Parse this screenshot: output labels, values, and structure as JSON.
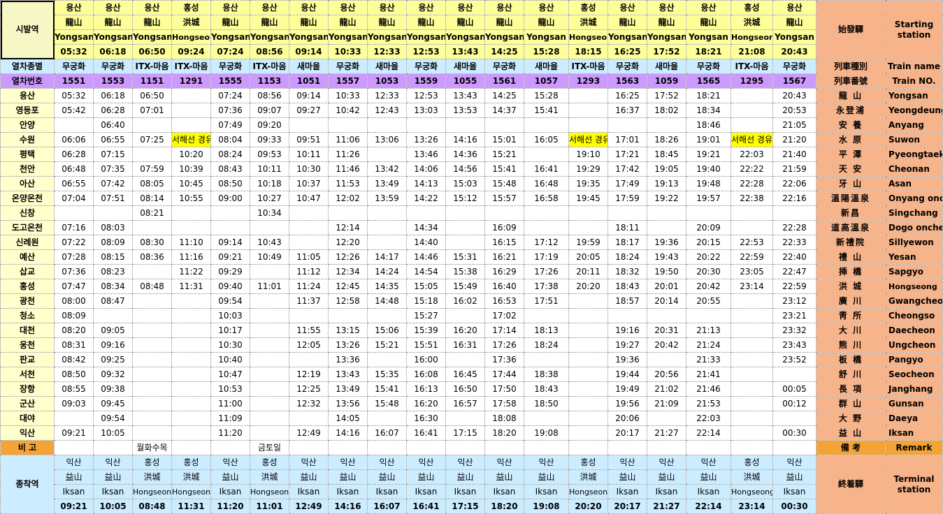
{
  "labels": {
    "start": "시발역",
    "start_hanja": "始發驛",
    "start_eng": "Starting station",
    "type": "열차종별",
    "type_hanja": "列車種別",
    "type_eng": "Train name",
    "no": "열차번호",
    "no_hanja": "列車番號",
    "no_eng": "Train NO.",
    "remark": "비 고",
    "remark_hanja": "備 考",
    "remark_eng": "Remark",
    "terminal": "종착역",
    "terminal_hanja": "終着驛",
    "terminal_eng": "Terminal station"
  },
  "trains": [
    {
      "sk": "용산",
      "sh": "龍山",
      "se": "Yongsan",
      "st": "05:32",
      "type": "무궁화",
      "no": "1551",
      "remark": "",
      "tk": "익산",
      "th": "益山",
      "te": "Iksan",
      "tt": "09:21"
    },
    {
      "sk": "용산",
      "sh": "龍山",
      "se": "Yongsan",
      "st": "06:18",
      "type": "무궁화",
      "no": "1553",
      "remark": "",
      "tk": "익산",
      "th": "益山",
      "te": "Iksan",
      "tt": "10:05"
    },
    {
      "sk": "용산",
      "sh": "龍山",
      "se": "Yongsan",
      "st": "06:50",
      "type": "ITX-마음",
      "no": "1151",
      "remark": "월화수목",
      "tk": "홍성",
      "th": "洪城",
      "te": "Hongseong",
      "tt": "08:48"
    },
    {
      "sk": "홍성",
      "sh": "洪城",
      "se": "Hongseong",
      "st": "09:24",
      "type": "ITX-마음",
      "no": "1291",
      "remark": "",
      "tk": "홍성",
      "th": "洪城",
      "te": "Hongseong",
      "tt": "11:31"
    },
    {
      "sk": "용산",
      "sh": "龍山",
      "se": "Yongsan",
      "st": "07:24",
      "type": "무궁화",
      "no": "1555",
      "remark": "",
      "tk": "익산",
      "th": "益山",
      "te": "Iksan",
      "tt": "11:20"
    },
    {
      "sk": "용산",
      "sh": "龍山",
      "se": "Yongsan",
      "st": "08:56",
      "type": "ITX-마음",
      "no": "1153",
      "remark": "금토일",
      "tk": "홍성",
      "th": "洪城",
      "te": "Hongseong",
      "tt": "11:01"
    },
    {
      "sk": "용산",
      "sh": "龍山",
      "se": "Yongsan",
      "st": "09:14",
      "type": "새마을",
      "no": "1051",
      "remark": "",
      "tk": "익산",
      "th": "益山",
      "te": "Iksan",
      "tt": "12:49"
    },
    {
      "sk": "용산",
      "sh": "龍山",
      "se": "Yongsan",
      "st": "10:33",
      "type": "무궁화",
      "no": "1557",
      "remark": "",
      "tk": "익산",
      "th": "益山",
      "te": "Iksan",
      "tt": "14:16"
    },
    {
      "sk": "용산",
      "sh": "龍山",
      "se": "Yongsan",
      "st": "12:33",
      "type": "새마을",
      "no": "1053",
      "remark": "",
      "tk": "익산",
      "th": "益山",
      "te": "Iksan",
      "tt": "16:07"
    },
    {
      "sk": "용산",
      "sh": "龍山",
      "se": "Yongsan",
      "st": "12:53",
      "type": "무궁화",
      "no": "1559",
      "remark": "",
      "tk": "익산",
      "th": "益山",
      "te": "Iksan",
      "tt": "16:41"
    },
    {
      "sk": "용산",
      "sh": "龍山",
      "se": "Yongsan",
      "st": "13:43",
      "type": "새마을",
      "no": "1055",
      "remark": "",
      "tk": "익산",
      "th": "益山",
      "te": "Iksan",
      "tt": "17:15"
    },
    {
      "sk": "용산",
      "sh": "龍山",
      "se": "Yongsan",
      "st": "14:25",
      "type": "무궁화",
      "no": "1561",
      "remark": "",
      "tk": "익산",
      "th": "益山",
      "te": "Iksan",
      "tt": "18:20"
    },
    {
      "sk": "용산",
      "sh": "龍山",
      "se": "Yongsan",
      "st": "15:28",
      "type": "새마을",
      "no": "1057",
      "remark": "",
      "tk": "익산",
      "th": "益山",
      "te": "Iksan",
      "tt": "19:08"
    },
    {
      "sk": "홍성",
      "sh": "洪城",
      "se": "Hongseong",
      "st": "18:15",
      "type": "ITX-마음",
      "no": "1293",
      "remark": "",
      "tk": "홍성",
      "th": "洪城",
      "te": "Hongseong",
      "tt": "20:20"
    },
    {
      "sk": "용산",
      "sh": "龍山",
      "se": "Yongsan",
      "st": "16:25",
      "type": "무궁화",
      "no": "1563",
      "remark": "",
      "tk": "익산",
      "th": "益山",
      "te": "Iksan",
      "tt": "20:17"
    },
    {
      "sk": "용산",
      "sh": "龍山",
      "se": "Yongsan",
      "st": "17:52",
      "type": "새마을",
      "no": "1059",
      "remark": "",
      "tk": "익산",
      "th": "益山",
      "te": "Iksan",
      "tt": "21:27"
    },
    {
      "sk": "용산",
      "sh": "龍山",
      "se": "Yongsan",
      "st": "18:21",
      "type": "무궁화",
      "no": "1565",
      "remark": "",
      "tk": "익산",
      "th": "益山",
      "te": "Iksan",
      "tt": "22:14"
    },
    {
      "sk": "홍성",
      "sh": "洪城",
      "se": "Hongseong",
      "st": "21:08",
      "type": "ITX-마음",
      "no": "1295",
      "remark": "",
      "tk": "홍성",
      "th": "洪城",
      "te": "Hongseong",
      "tt": "23:14"
    },
    {
      "sk": "용산",
      "sh": "龍山",
      "se": "Yongsan",
      "st": "20:43",
      "type": "무궁화",
      "no": "1567",
      "remark": "",
      "tk": "익산",
      "th": "益山",
      "te": "Iksan",
      "tt": "00:30"
    }
  ],
  "stations": [
    {
      "ko": "용산",
      "hanja": "龍 山",
      "en": "Yongsan",
      "times": [
        "05:32",
        "06:18",
        "06:50",
        "",
        "07:24",
        "08:56",
        "09:14",
        "10:33",
        "12:33",
        "12:53",
        "13:43",
        "14:25",
        "15:28",
        "",
        "16:25",
        "17:52",
        "18:21",
        "",
        "20:43"
      ]
    },
    {
      "ko": "영등포",
      "hanja": "永登浦",
      "en": "Yeongdeungpo",
      "times": [
        "05:42",
        "06:28",
        "07:01",
        "",
        "07:36",
        "09:07",
        "09:27",
        "10:42",
        "12:43",
        "13:03",
        "13:53",
        "14:37",
        "15:41",
        "",
        "16:37",
        "18:02",
        "18:34",
        "",
        "20:53"
      ]
    },
    {
      "ko": "안양",
      "hanja": "安 養",
      "en": "Anyang",
      "times": [
        "",
        "06:40",
        "",
        "",
        "07:49",
        "09:20",
        "",
        "",
        "",
        "",
        "",
        "",
        "",
        "",
        "",
        "",
        "18:46",
        "",
        "21:05"
      ]
    },
    {
      "ko": "수원",
      "hanja": "水 原",
      "en": "Suwon",
      "times": [
        "06:06",
        "06:55",
        "07:25",
        "서해선 경유",
        "08:04",
        "09:33",
        "09:51",
        "11:06",
        "13:06",
        "13:26",
        "14:16",
        "15:01",
        "16:05",
        "서해선 경유",
        "17:01",
        "18:26",
        "19:01",
        "서해선 경유",
        "21:20"
      ]
    },
    {
      "ko": "평택",
      "hanja": "平 澤",
      "en": "Pyeongtaek",
      "times": [
        "06:28",
        "07:15",
        "",
        "10:20",
        "08:24",
        "09:53",
        "10:11",
        "11:26",
        "",
        "13:46",
        "14:36",
        "15:21",
        "",
        "19:10",
        "17:21",
        "18:45",
        "19:21",
        "22:03",
        "21:40"
      ]
    },
    {
      "ko": "천안",
      "hanja": "天 安",
      "en": "Cheonan",
      "times": [
        "06:48",
        "07:35",
        "07:59",
        "10:39",
        "08:43",
        "10:11",
        "10:30",
        "11:46",
        "13:42",
        "14:06",
        "14:56",
        "15:41",
        "16:41",
        "19:29",
        "17:42",
        "19:05",
        "19:40",
        "22:22",
        "21:59"
      ]
    },
    {
      "ko": "아산",
      "hanja": "牙 山",
      "en": "Asan",
      "times": [
        "06:55",
        "07:42",
        "08:05",
        "10:45",
        "08:50",
        "10:18",
        "10:37",
        "11:53",
        "13:49",
        "14:13",
        "15:03",
        "15:48",
        "16:48",
        "19:35",
        "17:49",
        "19:13",
        "19:48",
        "22:28",
        "22:06"
      ]
    },
    {
      "ko": "온양온천",
      "hanja": "溫陽溫泉",
      "en": "Onyang oncheon",
      "times": [
        "07:04",
        "07:51",
        "08:14",
        "10:55",
        "09:00",
        "10:27",
        "10:47",
        "12:02",
        "13:59",
        "14:22",
        "15:12",
        "15:57",
        "16:58",
        "19:45",
        "17:59",
        "19:22",
        "19:57",
        "22:38",
        "22:16"
      ]
    },
    {
      "ko": "신창",
      "hanja": "新昌",
      "en": "Singchang",
      "times": [
        "",
        "",
        "08:21",
        "",
        "",
        "10:34",
        "",
        "",
        "",
        "",
        "",
        "",
        "",
        "",
        "",
        "",
        "",
        "",
        ""
      ]
    },
    {
      "ko": "도고온천",
      "hanja": "道高溫泉",
      "en": "Dogo oncheon",
      "times": [
        "07:16",
        "08:03",
        "",
        "",
        "",
        "",
        "",
        "12:14",
        "",
        "14:34",
        "",
        "16:09",
        "",
        "",
        "18:11",
        "",
        "20:09",
        "",
        "22:28"
      ]
    },
    {
      "ko": "신례원",
      "hanja": "新禮院",
      "en": "Sillyewon",
      "times": [
        "07:22",
        "08:09",
        "08:30",
        "11:10",
        "09:14",
        "10:43",
        "",
        "12:20",
        "",
        "14:40",
        "",
        "16:15",
        "17:12",
        "19:59",
        "18:17",
        "19:36",
        "20:15",
        "22:53",
        "22:33"
      ]
    },
    {
      "ko": "예산",
      "hanja": "禮 山",
      "en": "Yesan",
      "times": [
        "07:28",
        "08:15",
        "08:36",
        "11:16",
        "09:21",
        "10:49",
        "11:05",
        "12:26",
        "14:17",
        "14:46",
        "15:31",
        "16:21",
        "17:19",
        "20:05",
        "18:24",
        "19:43",
        "20:22",
        "22:59",
        "22:40"
      ]
    },
    {
      "ko": "삽교",
      "hanja": "揷 橋",
      "en": "Sapgyo",
      "times": [
        "07:36",
        "08:23",
        "",
        "11:22",
        "09:29",
        "",
        "11:12",
        "12:34",
        "14:24",
        "14:54",
        "15:38",
        "16:29",
        "17:26",
        "20:11",
        "18:32",
        "19:50",
        "20:30",
        "23:05",
        "22:47"
      ]
    },
    {
      "ko": "홍성",
      "hanja": "洪 城",
      "en": "Hongseong",
      "times": [
        "07:47",
        "08:34",
        "08:48",
        "11:31",
        "09:40",
        "11:01",
        "11:24",
        "12:45",
        "14:35",
        "15:05",
        "15:49",
        "16:40",
        "17:38",
        "20:20",
        "18:43",
        "20:01",
        "20:42",
        "23:14",
        "22:59"
      ]
    },
    {
      "ko": "광천",
      "hanja": "廣 川",
      "en": "Gwangcheon",
      "times": [
        "08:00",
        "08:47",
        "",
        "",
        "09:54",
        "",
        "11:37",
        "12:58",
        "14:48",
        "15:18",
        "16:02",
        "16:53",
        "17:51",
        "",
        "18:57",
        "20:14",
        "20:55",
        "",
        "23:12"
      ]
    },
    {
      "ko": "청소",
      "hanja": "靑 所",
      "en": "Cheongso",
      "times": [
        "08:09",
        "",
        "",
        "",
        "10:03",
        "",
        "",
        "",
        "",
        "15:27",
        "",
        "17:02",
        "",
        "",
        "",
        "",
        "",
        "",
        "23:21"
      ]
    },
    {
      "ko": "대천",
      "hanja": "大 川",
      "en": "Daecheon",
      "times": [
        "08:20",
        "09:05",
        "",
        "",
        "10:17",
        "",
        "11:55",
        "13:15",
        "15:06",
        "15:39",
        "16:20",
        "17:14",
        "18:13",
        "",
        "19:16",
        "20:31",
        "21:13",
        "",
        "23:32"
      ]
    },
    {
      "ko": "웅천",
      "hanja": "熊 川",
      "en": "Ungcheon",
      "times": [
        "08:31",
        "09:16",
        "",
        "",
        "10:30",
        "",
        "12:05",
        "13:26",
        "15:21",
        "15:51",
        "16:31",
        "17:26",
        "18:24",
        "",
        "19:27",
        "20:42",
        "21:24",
        "",
        "23:43"
      ]
    },
    {
      "ko": "판교",
      "hanja": "板 橋",
      "en": "Pangyo",
      "times": [
        "08:42",
        "09:25",
        "",
        "",
        "10:40",
        "",
        "",
        "13:36",
        "",
        "16:00",
        "",
        "17:36",
        "",
        "",
        "19:36",
        "",
        "21:33",
        "",
        "23:52"
      ]
    },
    {
      "ko": "서천",
      "hanja": "舒 川",
      "en": "Seocheon",
      "times": [
        "08:50",
        "09:32",
        "",
        "",
        "10:47",
        "",
        "12:19",
        "13:43",
        "15:35",
        "16:08",
        "16:45",
        "17:44",
        "18:38",
        "",
        "19:44",
        "20:56",
        "21:41",
        "",
        ""
      ]
    },
    {
      "ko": "장항",
      "hanja": "長 項",
      "en": "Janghang",
      "times": [
        "08:55",
        "09:38",
        "",
        "",
        "10:53",
        "",
        "12:25",
        "13:49",
        "15:41",
        "16:13",
        "16:50",
        "17:50",
        "18:43",
        "",
        "19:49",
        "21:02",
        "21:46",
        "",
        "00:05"
      ]
    },
    {
      "ko": "군산",
      "hanja": "群 山",
      "en": "Gunsan",
      "times": [
        "09:03",
        "09:45",
        "",
        "",
        "11:00",
        "",
        "12:32",
        "13:56",
        "15:48",
        "16:20",
        "16:57",
        "17:58",
        "18:50",
        "",
        "19:56",
        "21:09",
        "21:53",
        "",
        "00:12"
      ]
    },
    {
      "ko": "대야",
      "hanja": "大 野",
      "en": "Daeya",
      "times": [
        "",
        "09:54",
        "",
        "",
        "11:09",
        "",
        "",
        "14:05",
        "",
        "16:30",
        "",
        "18:08",
        "",
        "",
        "20:06",
        "",
        "22:03",
        "",
        ""
      ]
    },
    {
      "ko": "익산",
      "hanja": "益 山",
      "en": "Iksan",
      "times": [
        "09:21",
        "10:05",
        "",
        "",
        "11:20",
        "",
        "12:49",
        "14:16",
        "16:07",
        "16:41",
        "17:15",
        "18:20",
        "19:08",
        "",
        "20:17",
        "21:27",
        "22:14",
        "",
        "00:30"
      ]
    }
  ]
}
